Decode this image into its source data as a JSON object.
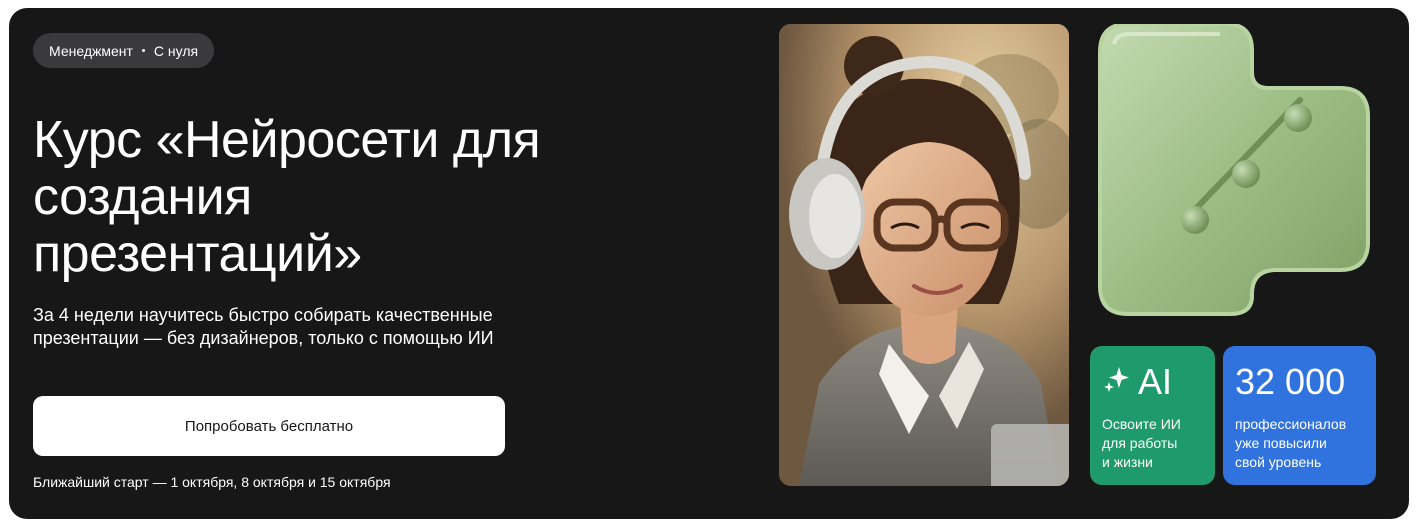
{
  "tag": {
    "category": "Менеджмент",
    "level": "С нуля"
  },
  "title": "Курс «Нейросети для создания презентаций»",
  "subtitle": "За 4 недели научитесь быстро собирать качественные презентации — без дизайнеров, только с помощью ИИ",
  "cta_label": "Попробовать бесплатно",
  "next_start": "Ближайший старт — 1 октября, 8 октября и 15 октября",
  "photo": {
    "icon": "woman-with-headphones-photo"
  },
  "shape": {
    "icon": "connected-dots-3d-shape",
    "color": "#9dbd86"
  },
  "cards": {
    "ai": {
      "value": "AI",
      "text": "Освоите ИИ\nдля работы\nи жизни",
      "color": "#1f9a6d",
      "icon": "sparkle-icon"
    },
    "pro": {
      "value": "32 000",
      "text": "профессионалов\nуже повысили\nсвой уровень",
      "color": "#3173de"
    }
  },
  "colors": {
    "background": "#171718",
    "tag_bg": "#3a3a3c",
    "button_bg": "#ffffff"
  }
}
